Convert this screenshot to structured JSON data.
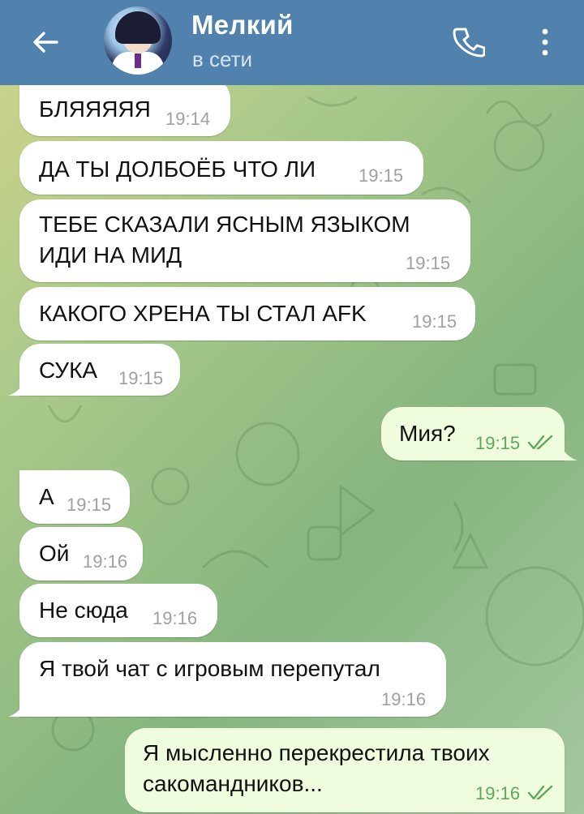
{
  "header": {
    "contact_name": "Мелкий",
    "status": "в сети",
    "back_icon": "arrow-left-icon",
    "call_icon": "phone-icon",
    "menu_icon": "more-vertical-icon",
    "color": "#5181ad"
  },
  "messages": [
    {
      "dir": "in",
      "text": "БЛЯЯЯЯЯ",
      "time": "19:14"
    },
    {
      "dir": "in",
      "text": "ДА ТЫ ДОЛБОЁБ ЧТО ЛИ",
      "time": "19:15"
    },
    {
      "dir": "in",
      "text": "ТЕБЕ СКАЗАЛИ ЯСНЫМ ЯЗЫКОМ\nИДИ НА МИД",
      "time": "19:15"
    },
    {
      "dir": "in",
      "text": "КАКОГО ХРЕНА ТЫ СТАЛ AFK",
      "time": "19:15"
    },
    {
      "dir": "in",
      "text": "СУКА",
      "time": "19:15"
    },
    {
      "dir": "out",
      "text": "Мия?",
      "time": "19:15",
      "read": true
    },
    {
      "dir": "in",
      "text": "А",
      "time": "19:15"
    },
    {
      "dir": "in",
      "text": "Ой",
      "time": "19:16"
    },
    {
      "dir": "in",
      "text": "Не сюда",
      "time": "19:16"
    },
    {
      "dir": "in",
      "text": "Я твой чат с игровым перепутал",
      "time": "19:16"
    },
    {
      "dir": "out",
      "text": "Я мысленно перекрестила твоих\nсакомандников...",
      "time": "19:16",
      "read": true
    }
  ],
  "colors": {
    "incoming": "#ffffff",
    "outgoing": "#effdde",
    "time_out": "#5fa85b",
    "time_in": "#a0a0a0"
  }
}
